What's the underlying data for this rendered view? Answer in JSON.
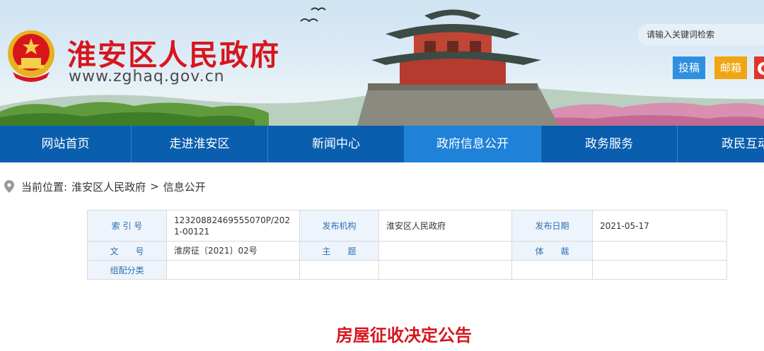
{
  "header": {
    "site_title": "淮安区人民政府",
    "site_url": "www.zghaq.gov.cn",
    "search_placeholder": "请输入关键词检索",
    "submit_label": "投稿",
    "mail_label": "邮箱"
  },
  "colors": {
    "brand_red": "#d7161c",
    "nav_blue": "#0a5eae",
    "nav_active": "#1f82d8",
    "label_bg": "#edf4fb",
    "label_text": "#2d6fb3"
  },
  "nav": {
    "items": [
      {
        "label": "网站首页",
        "active": false
      },
      {
        "label": "走进淮安区",
        "active": false
      },
      {
        "label": "新闻中心",
        "active": false
      },
      {
        "label": "政府信息公开",
        "active": true
      },
      {
        "label": "政务服务",
        "active": false
      },
      {
        "label": "政民互动",
        "active": false
      }
    ]
  },
  "breadcrumb": {
    "prefix": "当前位置:",
    "level1": "淮安区人民政府",
    "separator": ">",
    "level2": "信息公开"
  },
  "info": {
    "index_label": "索 引 号",
    "index_value": "12320882469555070P/2021-00121",
    "org_label": "发布机构",
    "org_value": "淮安区人民政府",
    "date_label": "发布日期",
    "date_value": "2021-05-17",
    "docno_label": "文　　号",
    "docno_value": "淮房征〔2021〕02号",
    "subject_label": "主　　题",
    "subject_value": "",
    "genre_label": "体　　裁",
    "genre_value": "",
    "category_label": "组配分类",
    "category_value": ""
  },
  "article": {
    "title": "房屋征收决定公告"
  }
}
